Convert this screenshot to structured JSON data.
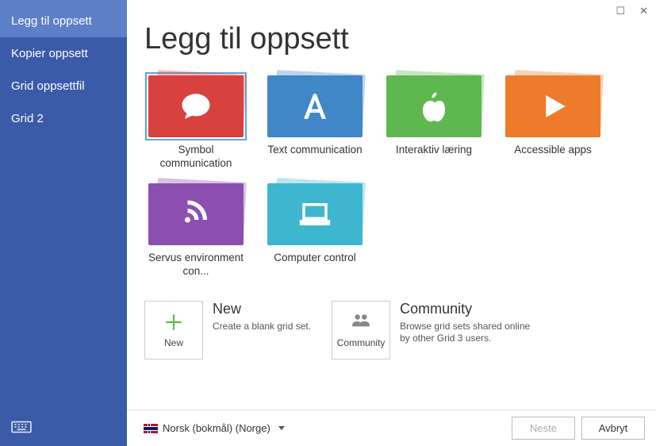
{
  "sidebar": {
    "items": [
      {
        "label": "Legg til oppsett",
        "active": true
      },
      {
        "label": "Kopier oppsett"
      },
      {
        "label": "Grid oppsettfil"
      },
      {
        "label": "Grid 2"
      }
    ]
  },
  "page": {
    "title": "Legg til oppsett"
  },
  "tiles": [
    {
      "label": "Symbol communication",
      "color": "#d9413f",
      "icon": "speech",
      "selected": true
    },
    {
      "label": "Text communication",
      "color": "#3f87c7",
      "icon": "letter-a"
    },
    {
      "label": "Interaktiv læring",
      "color": "#5fb84f",
      "icon": "apple"
    },
    {
      "label": "Accessible apps",
      "color": "#ee7b2a",
      "icon": "play"
    },
    {
      "label": "Servus environment con...",
      "color": "#8b4fb0",
      "icon": "signal"
    },
    {
      "label": "Computer control",
      "color": "#3fb6cf",
      "icon": "laptop"
    }
  ],
  "options": {
    "new": {
      "card_label": "New",
      "title": "New",
      "desc": "Create a blank grid set.",
      "icon": "plus",
      "icon_color": "#5fb84f"
    },
    "community": {
      "card_label": "Community",
      "title": "Community",
      "desc": "Browse grid sets shared online by other Grid 3 users.",
      "icon": "users",
      "icon_color": "#888"
    }
  },
  "footer": {
    "language": "Norsk (bokmål) (Norge)",
    "next": "Neste",
    "cancel": "Avbryt"
  },
  "window": {
    "maximize": "☐",
    "close": "✕"
  }
}
